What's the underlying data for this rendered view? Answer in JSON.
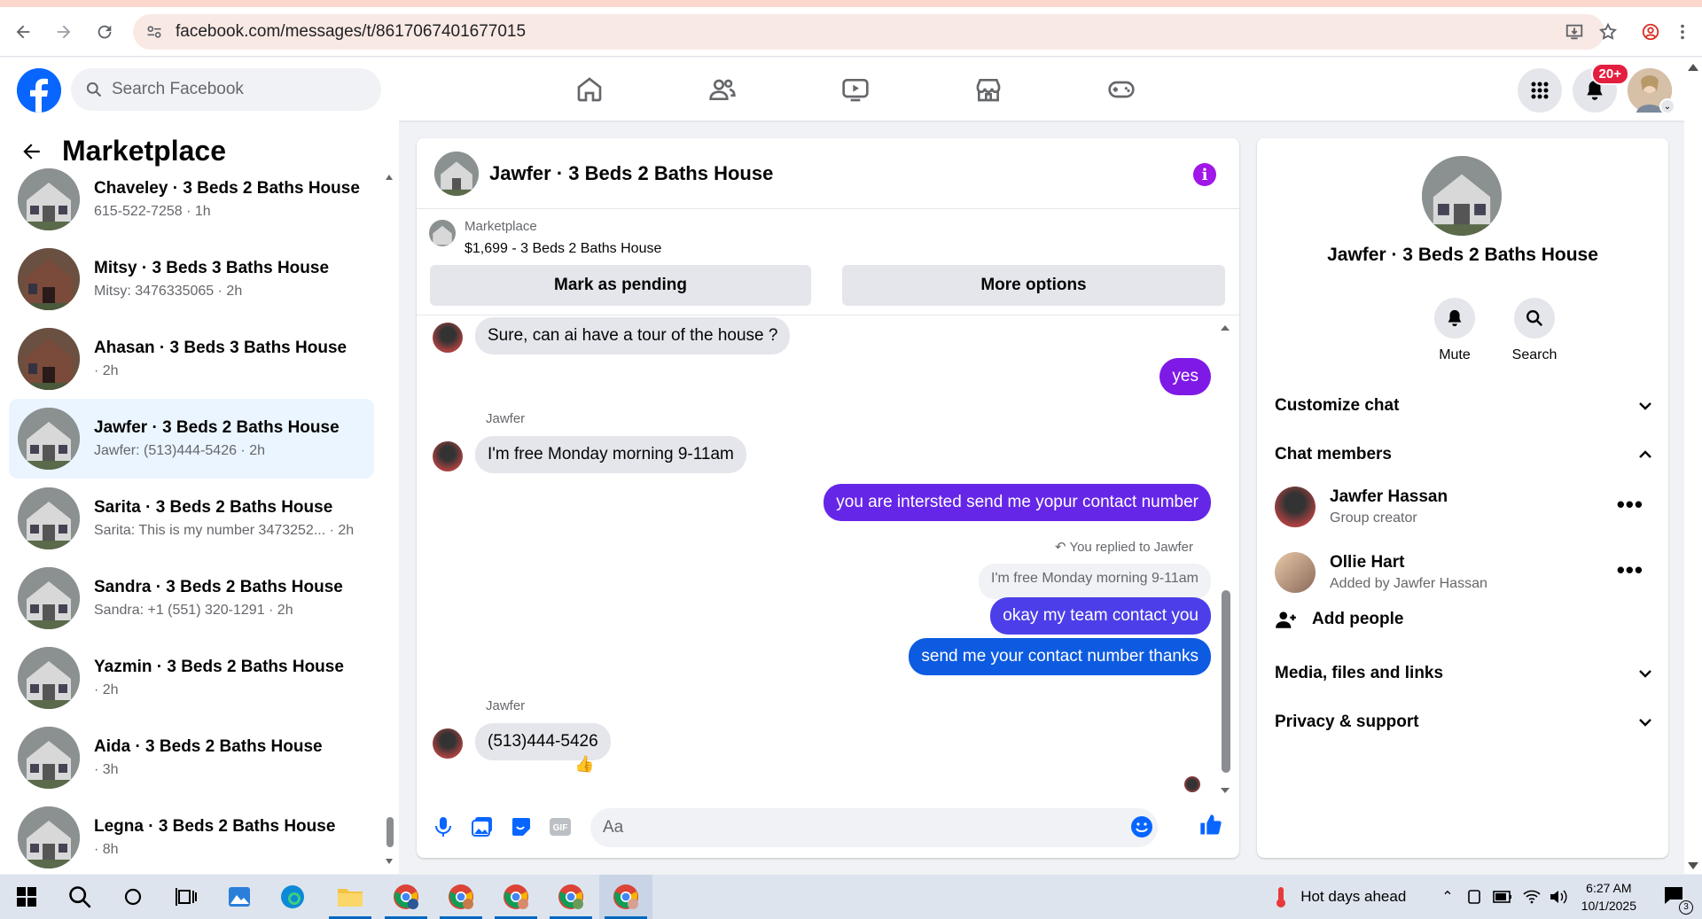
{
  "browser": {
    "url": "facebook.com/messages/t/8617067401677015"
  },
  "header": {
    "search_placeholder": "Search Facebook",
    "notification_badge": "20+"
  },
  "sidebar": {
    "title": "Marketplace",
    "conversations": [
      {
        "title": "Chaveley · 3 Beds 2 Baths House",
        "sub": "615-522-7258 · 1h"
      },
      {
        "title": "Mitsy · 3 Beds 3 Baths House",
        "sub": "Mitsy: 3476335065 · 2h"
      },
      {
        "title": "Ahasan · 3 Beds 3 Baths House",
        "sub": "· 2h"
      },
      {
        "title": "Jawfer · 3 Beds 2 Baths House",
        "sub": "Jawfer: (513)444-5426 · 2h"
      },
      {
        "title": "Sarita · 3 Beds 2 Baths House",
        "sub": "Sarita: This is my number 3473252...  · 2h"
      },
      {
        "title": "Sandra · 3 Beds 2 Baths House",
        "sub": "Sandra: +1 (551) 320-1291 · 2h"
      },
      {
        "title": "Yazmin · 3 Beds 2 Baths House",
        "sub": "· 2h"
      },
      {
        "title": "Aida · 3 Beds 2 Baths House",
        "sub": "· 3h"
      },
      {
        "title": "Legna · 3 Beds 2 Baths House",
        "sub": "· 8h"
      }
    ]
  },
  "chat": {
    "title": "Jawfer · 3 Beds 2 Baths House",
    "marketplace_label": "Marketplace",
    "listing": "$1,699 - 3 Beds 2 Baths House",
    "mark_pending": "Mark as pending",
    "more_options": "More options",
    "messages": {
      "m1": "Sure, can ai have a tour of the house ?",
      "m2": "yes",
      "sender1": "Jawfer",
      "m3": "I'm free Monday morning 9-11am",
      "m4": "you are intersted send me yopur contact number",
      "reply_note": "You replied to Jawfer",
      "quoted": "I'm free Monday morning 9-11am",
      "m5": "okay my team contact you",
      "m6": "send me your contact number thanks",
      "sender2": "Jawfer",
      "m7": "(513)444-5426",
      "reaction": "👍"
    },
    "composer_placeholder": "Aa"
  },
  "details": {
    "title": "Jawfer · 3 Beds 2 Baths House",
    "mute": "Mute",
    "search": "Search",
    "customize": "Customize chat",
    "members_header": "Chat members",
    "members": [
      {
        "name": "Jawfer Hassan",
        "role": "Group creator"
      },
      {
        "name": "Ollie Hart",
        "role": "Added by Jawfer Hassan"
      }
    ],
    "add_people": "Add people",
    "media": "Media, files and links",
    "privacy": "Privacy & support"
  },
  "taskbar": {
    "weather": "Hot days ahead",
    "time": "6:27 AM",
    "date": "10/1/2025",
    "notif_count": "3"
  },
  "colors": {
    "fb_blue": "#0866ff",
    "purple_bubble": "#7f19e6",
    "indigo_bubble": "#4c3ee8",
    "blue_bubble": "#0d5be1"
  }
}
